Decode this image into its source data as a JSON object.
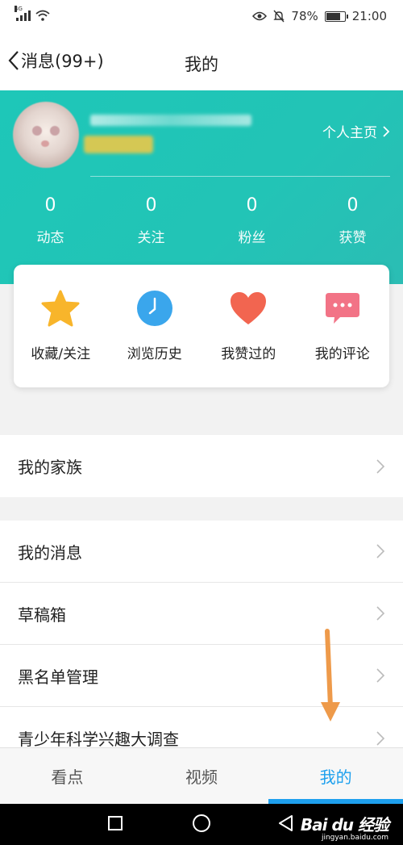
{
  "status_bar": {
    "network": "4G",
    "battery_percent": "78%",
    "time": "21:00"
  },
  "header": {
    "back_label": "消息(99+)",
    "title": "我的"
  },
  "profile": {
    "homepage_label": "个人主页",
    "stats": [
      {
        "value": "0",
        "label": "动态"
      },
      {
        "value": "0",
        "label": "关注"
      },
      {
        "value": "0",
        "label": "粉丝"
      },
      {
        "value": "0",
        "label": "获赞"
      }
    ]
  },
  "quick_actions": [
    {
      "label": "收藏/关注",
      "icon": "star-icon",
      "color": "#f8b52b"
    },
    {
      "label": "浏览历史",
      "icon": "clock-icon",
      "color": "#3aa6ec"
    },
    {
      "label": "我赞过的",
      "icon": "heart-icon",
      "color": "#f26550"
    },
    {
      "label": "我的评论",
      "icon": "comment-icon",
      "color": "#f27386"
    }
  ],
  "menu_section_1": [
    {
      "label": "我的家族"
    }
  ],
  "menu_section_2": [
    {
      "label": "我的消息"
    },
    {
      "label": "草稿箱"
    },
    {
      "label": "黑名单管理"
    },
    {
      "label": "青少年科学兴趣大调查"
    }
  ],
  "tabs": [
    {
      "label": "看点",
      "active": false
    },
    {
      "label": "视频",
      "active": false
    },
    {
      "label": "我的",
      "active": true
    }
  ],
  "watermark": {
    "logo": "Bai du 经验",
    "site": "jingyan.baidu.com"
  },
  "colors": {
    "accent": "#1ea0ee",
    "profile_bg": "#22c4b6",
    "arrow": "#ee9a4a"
  }
}
